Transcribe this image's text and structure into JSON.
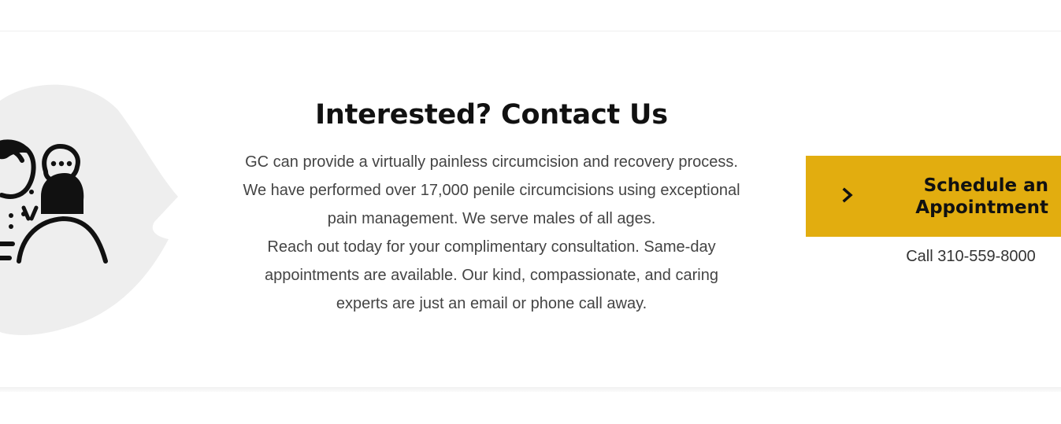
{
  "contact": {
    "title": "Interested? Contact Us",
    "paragraphs": [
      "GC can provide a virtually painless circumcision and recovery process.",
      "We have performed over 17,000 penile circumcisions using exceptional",
      "pain management. We serve males of all ages.",
      "Reach out today for your complimentary consultation. Same-day",
      "appointments are available. Our kind, compassionate, and caring",
      "experts are just an email or phone call away."
    ]
  },
  "cta": {
    "line1": "Schedule an",
    "line2": "Appointment",
    "icon": "chevron-right-icon",
    "color": "#e2ad0f"
  },
  "phone": {
    "text": "Call 310-559-8000"
  },
  "illustration": {
    "icon": "consultation-icon"
  }
}
